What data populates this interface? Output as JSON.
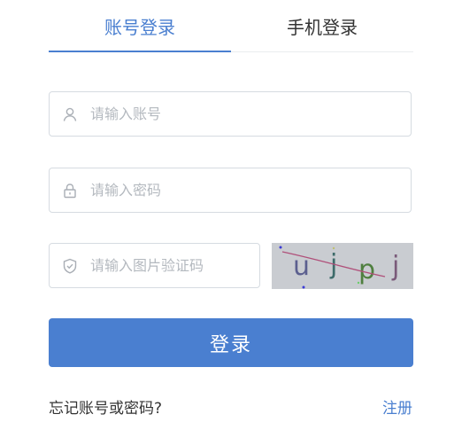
{
  "tabs": {
    "account_label": "账号登录",
    "phone_label": "手机登录"
  },
  "form": {
    "account_placeholder": "请输入账号",
    "password_placeholder": "请输入密码",
    "captcha_placeholder": "请输入图片验证码",
    "captcha_text": "ujpj",
    "login_label": "登录"
  },
  "links": {
    "forgot_label": "忘记账号或密码?",
    "register_label": "注册"
  },
  "icons": {
    "account": "user-icon",
    "password": "lock-icon",
    "captcha": "shield-icon"
  },
  "colors": {
    "accent": "#4a7fd0",
    "border": "#d6dbe1",
    "placeholder": "#b4b9bf",
    "captcha_bg": "#c9ccd1"
  }
}
